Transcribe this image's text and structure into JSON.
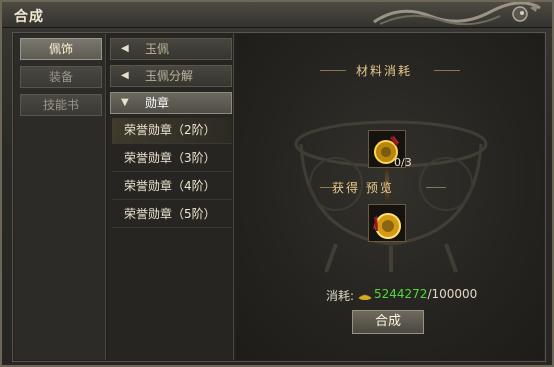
{
  "window": {
    "title": "合成"
  },
  "tabs": [
    {
      "label": "佩饰",
      "active": true
    },
    {
      "label": "装备",
      "active": false
    },
    {
      "label": "技能书",
      "active": false
    }
  ],
  "categories": [
    {
      "label": "玉佩",
      "arrow": "◀",
      "open": false
    },
    {
      "label": "玉佩分解",
      "arrow": "◀",
      "open": false
    },
    {
      "label": "勋章",
      "arrow": "▼",
      "open": true
    }
  ],
  "sub_items": [
    {
      "label": "荣誉勋章（2阶）",
      "selected": true
    },
    {
      "label": "荣誉勋章（3阶）",
      "selected": false
    },
    {
      "label": "荣誉勋章（4阶）",
      "selected": false
    },
    {
      "label": "荣誉勋章（5阶）",
      "selected": false
    }
  ],
  "preview": {
    "materials_heading": "材料消耗",
    "material_qty": "0/3",
    "result_heading": "获得 预览",
    "cost_label": "消耗:",
    "cost_have": "5244272",
    "cost_sep": "/",
    "cost_need": "100000",
    "craft_button": "合成"
  },
  "colors": {
    "accent": "#e9c98a",
    "have": "#4fdc3a",
    "frame": "#6e6656"
  }
}
